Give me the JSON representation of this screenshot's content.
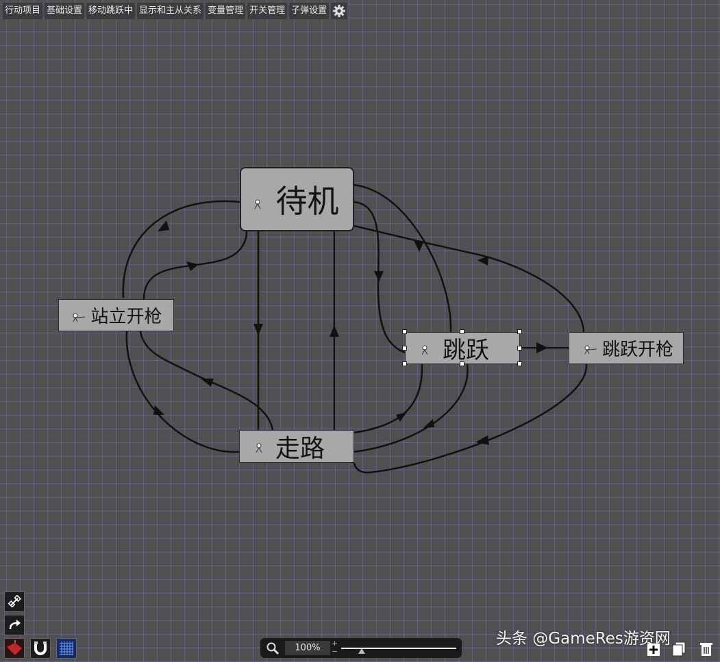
{
  "menu": {
    "tabs": [
      {
        "label": "行动项目"
      },
      {
        "label": "基础设置"
      },
      {
        "label": "移动跳跃中"
      },
      {
        "label": "显示和主从关系"
      },
      {
        "label": "变量管理"
      },
      {
        "label": "开关管理"
      },
      {
        "label": "子弹设置"
      }
    ],
    "settings_icon": "gear-icon"
  },
  "graph": {
    "nodes": {
      "idle": {
        "label": "待机"
      },
      "stand_shoot": {
        "label": "站立开枪"
      },
      "walk": {
        "label": "走路"
      },
      "jump": {
        "label": "跳跃"
      },
      "jump_shoot": {
        "label": "跳跃开枪"
      }
    },
    "selected_node": "jump",
    "edge_color": "#111111",
    "node_color": "#a8a8a8"
  },
  "tools": {
    "items": [
      "link-icon",
      "redo-icon",
      "fill-icon",
      "magnet-icon",
      "grid-icon"
    ]
  },
  "zoom": {
    "value": "100%",
    "slider_level": 0.18
  },
  "bottom_right": {
    "items": [
      "add-icon",
      "copy-icon",
      "delete-icon"
    ]
  },
  "watermark": {
    "text": "头条 @GameRes游资网"
  },
  "colors": {
    "canvas_bg": "#505052",
    "grid_line": "#7882ff",
    "menu_bg": "#3c3c3e"
  }
}
